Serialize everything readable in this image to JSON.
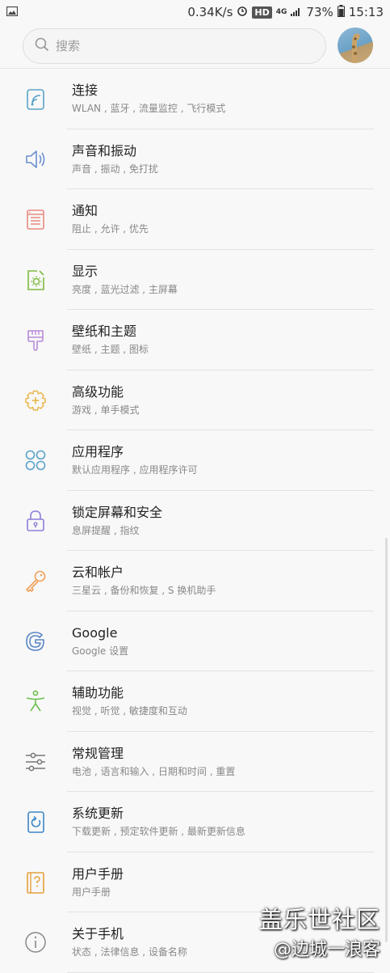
{
  "status_bar": {
    "speed": "0.34K/s",
    "hd": "HD",
    "network": "4G",
    "battery": "73%",
    "time": "15:13"
  },
  "search": {
    "placeholder": "搜索"
  },
  "items": [
    {
      "title": "连接",
      "sub": "WLAN , 蓝牙 , 流量监控 , 飞行模式",
      "icon": "connection-icon",
      "color": "#5aa2c8"
    },
    {
      "title": "声音和振动",
      "sub": "声音 , 振动 , 免打扰",
      "icon": "speaker-icon",
      "color": "#6a8fd0"
    },
    {
      "title": "通知",
      "sub": "阻止 , 允许 , 优先",
      "icon": "notification-icon",
      "color": "#e98a7f"
    },
    {
      "title": "显示",
      "sub": "亮度 , 蓝光过滤 , 主屏幕",
      "icon": "display-icon",
      "color": "#7dbb3f"
    },
    {
      "title": "壁纸和主题",
      "sub": "壁纸 , 主题 , 图标",
      "icon": "brush-icon",
      "color": "#b88bd9"
    },
    {
      "title": "高级功能",
      "sub": "游戏 , 单手模式",
      "icon": "gear-plus-icon",
      "color": "#e8b64a"
    },
    {
      "title": "应用程序",
      "sub": "默认应用程序 , 应用程序许可",
      "icon": "apps-icon",
      "color": "#5aa2c8"
    },
    {
      "title": "锁定屏幕和安全",
      "sub": "息屏提醒 , 指纹",
      "icon": "lock-icon",
      "color": "#8c7fd8"
    },
    {
      "title": "云和帐户",
      "sub": "三星云 , 备份和恢复 , S 换机助手",
      "icon": "key-icon",
      "color": "#f0a05a"
    },
    {
      "title": "Google",
      "sub": "Google 设置",
      "icon": "google-icon",
      "color": "#5a85c4"
    },
    {
      "title": "辅助功能",
      "sub": "视觉 , 听觉 , 敏捷度和互动",
      "icon": "accessibility-icon",
      "color": "#6bbf4f"
    },
    {
      "title": "常规管理",
      "sub": "电池 , 语言和输入 , 日期和时间 , 重置",
      "icon": "sliders-icon",
      "color": "#777777"
    },
    {
      "title": "系统更新",
      "sub": "下载更新 , 预定软件更新 , 最新更新信息",
      "icon": "update-icon",
      "color": "#3d86c6"
    },
    {
      "title": "用户手册",
      "sub": "用户手册",
      "icon": "manual-icon",
      "color": "#e4a13a"
    },
    {
      "title": "关于手机",
      "sub": "状态 , 法律信息 , 设备名称",
      "icon": "info-icon",
      "color": "#888888"
    }
  ],
  "watermark": {
    "line1": "盖乐世社区",
    "line2": "@边城一浪客"
  }
}
